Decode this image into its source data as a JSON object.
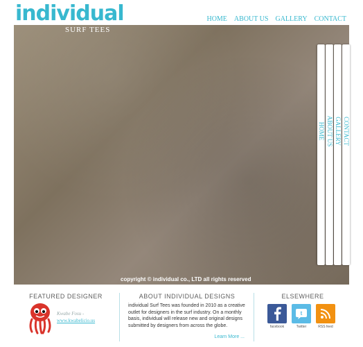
{
  "brand": {
    "name": "individual",
    "tagline": "SURF TEES"
  },
  "nav": {
    "items": [
      "HOME",
      "ABOUT US",
      "GALLERY",
      "CONTACT"
    ]
  },
  "side_nav": {
    "items": [
      "HOME",
      "ABOUT US",
      "GALLERY",
      "CONTACT"
    ]
  },
  "hero": {
    "copyright": "copyright © individual co., LTD all rights reserved"
  },
  "footer": {
    "featured": {
      "title": "FEATURED DESIGNER",
      "designer_name": "Kwabe Fosu -",
      "designer_url": "www.kwabelicio.us"
    },
    "about": {
      "title": "ABOUT INDIVIDUAL DESIGNS",
      "text": "individual Surf Tees was founded in 2010 as a creative outlet for designers in the surf industry. On a monthly basis, individual will release new and original designs submitted by designers from across the globe.",
      "learn_more": "Learn More ..."
    },
    "elsewhere": {
      "title": "ELSEWHERE",
      "links": [
        {
          "label": "facebook",
          "icon": "facebook-icon",
          "color": "#3b5998"
        },
        {
          "label": "Twitter",
          "icon": "twitter-icon",
          "color": "#5bbbe6"
        },
        {
          "label": "RSS feed",
          "icon": "rss-icon",
          "color": "#f29111"
        }
      ]
    }
  }
}
